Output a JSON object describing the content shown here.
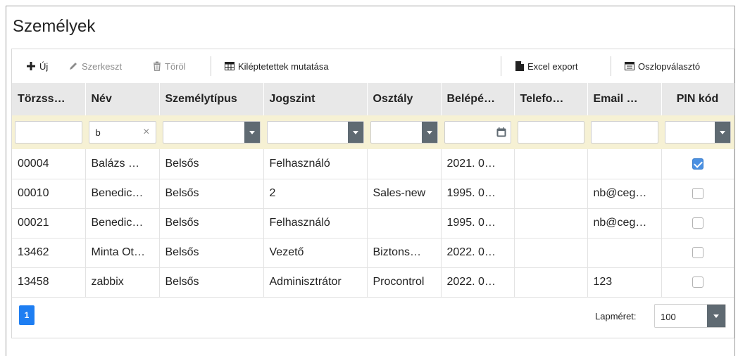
{
  "page": {
    "title": "Személyek"
  },
  "toolbar": {
    "new_label": "Új",
    "edit_label": "Szerkeszt",
    "delete_label": "Töröl",
    "show_exited_label": "Kiléptetettek mutatása",
    "excel_export_label": "Excel export",
    "column_chooser_label": "Oszlopválasztó"
  },
  "grid": {
    "columns": [
      "Törzss…",
      "Név",
      "Személytípus",
      "Jogszint",
      "Osztály",
      "Belépé…",
      "Telefo…",
      "Email …",
      "PIN kód"
    ],
    "filters": {
      "name_value": "b"
    },
    "rows": [
      {
        "id": "00004",
        "name": "Balázs …",
        "type": "Belsős",
        "level": "Felhasználó",
        "dept": "",
        "entry": "2021. 0…",
        "phone": "",
        "email": "",
        "pin": true
      },
      {
        "id": "00010",
        "name": "Benedic…",
        "type": "Belsős",
        "level": "2",
        "dept": "Sales-new",
        "entry": "1995. 0…",
        "phone": "",
        "email": "nb@ceg…",
        "pin": false
      },
      {
        "id": "00021",
        "name": "Benedic…",
        "type": "Belsős",
        "level": "Felhasználó",
        "dept": "",
        "entry": "1995. 0…",
        "phone": "",
        "email": "nb@ceg…",
        "pin": false
      },
      {
        "id": "13462",
        "name": "Minta Ot…",
        "type": "Belsős",
        "level": "Vezető",
        "dept": "Biztons…",
        "entry": "2022. 0…",
        "phone": "",
        "email": "",
        "pin": false
      },
      {
        "id": "13458",
        "name": "zabbix",
        "type": "Belsős",
        "level": "Adminisztrátor",
        "dept": "Procontrol",
        "entry": "2022. 0…",
        "phone": "",
        "email": "123",
        "pin": false
      }
    ]
  },
  "footer": {
    "current_page": "1",
    "page_size_label": "Lapméret:",
    "page_size_value": "100"
  },
  "colors": {
    "accent": "#1e7ef2",
    "header_bg": "#e8e8e8",
    "filter_bg": "#f6f1d4",
    "dropdown_btn": "#5f6a72"
  }
}
